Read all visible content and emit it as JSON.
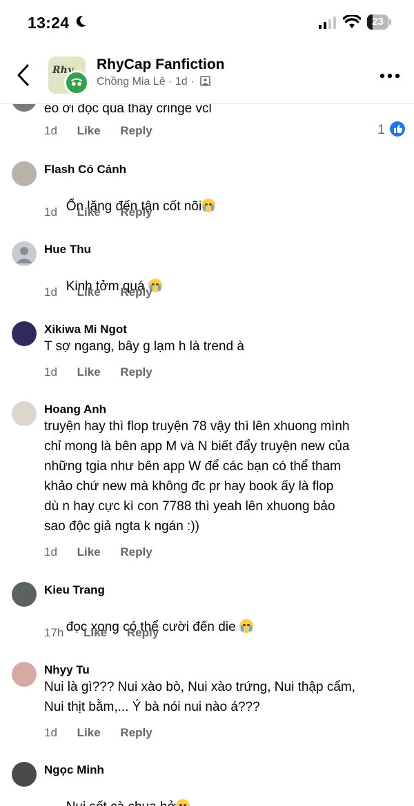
{
  "status_bar": {
    "time": "13:24",
    "battery": "23"
  },
  "header": {
    "group_name": "RhyCap Fanfiction",
    "subtitle": "Chồng Mia Lê · 1d ·",
    "logo_text": "Rhy"
  },
  "comments": [
    {
      "name": "",
      "text": "eo ơi đọc qua thấy cringe vcl",
      "age": "1d",
      "like": "Like",
      "reply": "Reply",
      "reaction_count": "1"
    },
    {
      "name": "Flash Có Cánh",
      "text": "Ổn lặng đến tận cốt nõi",
      "age": "1d",
      "like": "Like",
      "reply": "Reply"
    },
    {
      "name": "Hue Thu",
      "text": "Kinh tởm quá",
      "age": "1d",
      "like": "Like",
      "reply": "Reply"
    },
    {
      "name": "Xikiwa Mi Ngot",
      "text": "T sợ ngang, bây g lạm h là trend à",
      "age": "1d",
      "like": "Like",
      "reply": "Reply"
    },
    {
      "name": "Hoang Anh",
      "text": "truyện hay thì flop truyện 78 vậy thì lên xhuong mình\nchỉ mong là bên app M và N biết đẩy truyện new của\nnhững tgia như bên app W để các bạn có thể tham\nkhảo chứ new mà không đc pr hay book ấy là flop\ndù n hay cực kì con 7788 thì yeah lên xhuong bảo\nsao độc giả ngta k ngán :))",
      "age": "1d",
      "like": "Like",
      "reply": "Reply"
    },
    {
      "name": "Kieu Trang",
      "text": "đọc xong có thể cười đến die",
      "age": "17h",
      "like": "Like",
      "reply": "Reply"
    },
    {
      "name": "Nhyy Tu",
      "text": "Nui là gì??? Nui xào bò, Nui xào trứng, Nui thập cẩm,\nNui thịt bằm,... Ý bà nói nui nào á???",
      "age": "1d",
      "like": "Like",
      "reply": "Reply"
    },
    {
      "name": "Ngọc Minh",
      "text": "Nui sốt cà chua hở",
      "age": "",
      "like": "",
      "reply": ""
    }
  ],
  "icons": {
    "back": "chevron-left-icon",
    "more": "more-horizontal-icon",
    "like_reaction": "thumbs-up-icon",
    "crying": "loudly-crying-face-emoji",
    "smiling": "smiling-face-emoji",
    "photo": "photo-icon",
    "moon": "moon-icon"
  },
  "colors": {
    "link_blue": "#1877f2",
    "meta_gray": "#65676b",
    "badge_green": "#31a24c"
  }
}
